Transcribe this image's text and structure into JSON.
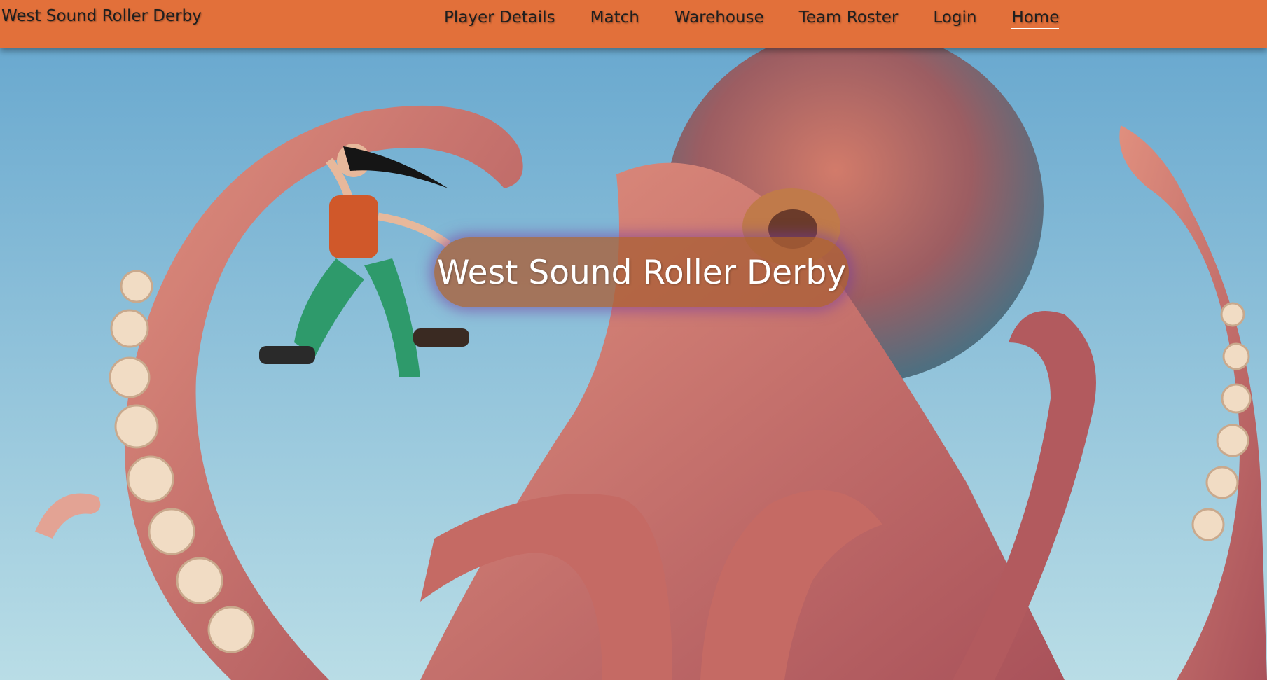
{
  "site": {
    "brand": "West Sound Roller Derby"
  },
  "nav": {
    "items": [
      {
        "label": "Player Details"
      },
      {
        "label": "Match"
      },
      {
        "label": "Warehouse"
      },
      {
        "label": "Team Roster"
      },
      {
        "label": "Login"
      },
      {
        "label": "Home"
      }
    ],
    "active": "Home"
  },
  "hero": {
    "title": "West Sound Roller Derby",
    "image_subject": "giant octopus with roller skater"
  },
  "colors": {
    "navbar": "#e2703a",
    "title_pill": "#aa5f37",
    "sky": "#7fb6d6",
    "octopus": "#c96a5e"
  }
}
